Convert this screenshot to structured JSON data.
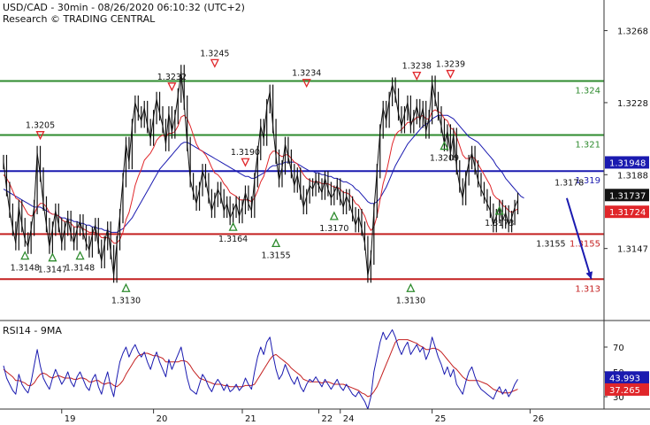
{
  "header": {
    "line1": "USD/CAD - 30min - 08/26/2020 06:10:32 (UTC+2)",
    "line2": "Research © TRADING CENTRAL"
  },
  "rsi_title": "RSI14 - 9MA",
  "chart_data": [
    {
      "type": "line",
      "name": "price",
      "ylim": [
        1.3108,
        1.3285
      ],
      "y_ticks": [
        "1.3268",
        "1.3228",
        "1.3188",
        "1.3147"
      ],
      "y_tick_values": [
        1.3268,
        1.3228,
        1.3188,
        1.3147
      ],
      "x_ticks": [
        "19",
        "20",
        "21",
        "22",
        "24",
        "25",
        "26"
      ],
      "x_tick_index": [
        19,
        49,
        78,
        103,
        110,
        140,
        172
      ],
      "close": [
        1.3195,
        1.318,
        1.3168,
        1.3158,
        1.315,
        1.317,
        1.316,
        1.3152,
        1.3148,
        1.3158,
        1.317,
        1.32,
        1.3188,
        1.3172,
        1.316,
        1.3148,
        1.3158,
        1.3168,
        1.316,
        1.315,
        1.3158,
        1.3164,
        1.3155,
        1.315,
        1.3158,
        1.3162,
        1.3156,
        1.315,
        1.3146,
        1.3155,
        1.316,
        1.3148,
        1.314,
        1.315,
        1.3158,
        1.3145,
        1.3132,
        1.315,
        1.3165,
        1.3185,
        1.3205,
        1.3195,
        1.3215,
        1.3228,
        1.3222,
        1.3218,
        1.3225,
        1.3215,
        1.3208,
        1.322,
        1.323,
        1.3222,
        1.3215,
        1.3205,
        1.3222,
        1.3212,
        1.322,
        1.3232,
        1.3245,
        1.3228,
        1.3205,
        1.3185,
        1.3178,
        1.3172,
        1.318,
        1.319,
        1.3185,
        1.3176,
        1.3168,
        1.3174,
        1.318,
        1.3176,
        1.3168,
        1.3172,
        1.3164,
        1.3168,
        1.3172,
        1.3165,
        1.317,
        1.3178,
        1.3172,
        1.3168,
        1.3185,
        1.32,
        1.3215,
        1.3208,
        1.3226,
        1.3234,
        1.3215,
        1.3198,
        1.3185,
        1.3192,
        1.3205,
        1.3198,
        1.319,
        1.3182,
        1.3188,
        1.3178,
        1.317,
        1.3176,
        1.3182,
        1.318,
        1.3185,
        1.3182,
        1.3178,
        1.3186,
        1.318,
        1.3175,
        1.3178,
        1.3182,
        1.3175,
        1.317,
        1.3176,
        1.3172,
        1.3166,
        1.316,
        1.3165,
        1.3158,
        1.315,
        1.3132,
        1.3142,
        1.3168,
        1.319,
        1.3212,
        1.3225,
        1.3218,
        1.323,
        1.3238,
        1.3232,
        1.3222,
        1.3215,
        1.3222,
        1.3228,
        1.3215,
        1.322,
        1.3226,
        1.3218,
        1.3225,
        1.3212,
        1.322,
        1.3239,
        1.323,
        1.3222,
        1.3215,
        1.3205,
        1.3212,
        1.32,
        1.321,
        1.3192,
        1.3182,
        1.3175,
        1.3186,
        1.3195,
        1.32,
        1.3192,
        1.3185,
        1.318,
        1.3176,
        1.3172,
        1.3168,
        1.316,
        1.3165,
        1.317,
        1.3162,
        1.3167,
        1.316,
        1.3164,
        1.317,
        1.3174
      ],
      "ma_fast": [
        1.3188,
        1.3186,
        1.3183,
        1.3179,
        1.3175,
        1.3174,
        1.3172,
        1.3169,
        1.3166,
        1.3165,
        1.3166,
        1.317,
        1.3172,
        1.3172,
        1.317,
        1.3167,
        1.3166,
        1.3166,
        1.3165,
        1.3163,
        1.3162,
        1.3162,
        1.3161,
        1.3159,
        1.3159,
        1.3159,
        1.3158,
        1.3157,
        1.3156,
        1.3156,
        1.3156,
        1.3155,
        1.3153,
        1.3153,
        1.3153,
        1.3152,
        1.315,
        1.315,
        1.3152,
        1.3156,
        1.3163,
        1.3167,
        1.3174,
        1.3182,
        1.3187,
        1.3191,
        1.3196,
        1.3198,
        1.32,
        1.3203,
        1.3207,
        1.3209,
        1.321,
        1.3209,
        1.3211,
        1.3211,
        1.3212,
        1.3215,
        1.322,
        1.3221,
        1.3219,
        1.3215,
        1.321,
        1.3205,
        1.3202,
        1.3201,
        1.3199,
        1.3196,
        1.3192,
        1.3189,
        1.3188,
        1.3186,
        1.3183,
        1.3181,
        1.3178,
        1.3177,
        1.3176,
        1.3174,
        1.3174,
        1.3174,
        1.3174,
        1.3173,
        1.3175,
        1.3179,
        1.3184,
        1.3187,
        1.3193,
        1.3199,
        1.3201,
        1.3201,
        1.3199,
        1.3198,
        1.3199,
        1.3199,
        1.3197,
        1.3195,
        1.3194,
        1.3191,
        1.3188,
        1.3186,
        1.3185,
        1.3184,
        1.3184,
        1.3184,
        1.3183,
        1.3183,
        1.3183,
        1.3182,
        1.3181,
        1.3181,
        1.318,
        1.3178,
        1.3178,
        1.3177,
        1.3175,
        1.3172,
        1.3171,
        1.3168,
        1.3165,
        1.316,
        1.3157,
        1.3159,
        1.3165,
        1.3174,
        1.3183,
        1.3189,
        1.3197,
        1.3205,
        1.321,
        1.3212,
        1.3213,
        1.3215,
        1.3217,
        1.3217,
        1.3218,
        1.322,
        1.322,
        1.3221,
        1.3219,
        1.3219,
        1.3223,
        1.3224,
        1.3223,
        1.3222,
        1.3219,
        1.3218,
        1.3214,
        1.3213,
        1.3209,
        1.3204,
        1.3199,
        1.3197,
        1.3197,
        1.3198,
        1.3197,
        1.3194,
        1.3191,
        1.3188,
        1.3185,
        1.3182,
        1.3177,
        1.3175,
        1.3174,
        1.3171,
        1.317,
        1.3168,
        1.3167,
        1.3168,
        1.3169
      ],
      "ma_slow": [
        1.318,
        1.3179,
        1.3178,
        1.3177,
        1.3176,
        1.3175,
        1.3174,
        1.3173,
        1.3172,
        1.3171,
        1.317,
        1.317,
        1.317,
        1.3169,
        1.3168,
        1.3167,
        1.3166,
        1.3166,
        1.3165,
        1.3164,
        1.3164,
        1.3163,
        1.3163,
        1.3162,
        1.3162,
        1.3161,
        1.3161,
        1.316,
        1.316,
        1.3159,
        1.3159,
        1.3158,
        1.3158,
        1.3157,
        1.3157,
        1.3156,
        1.3156,
        1.3156,
        1.3157,
        1.3158,
        1.316,
        1.3162,
        1.3164,
        1.3167,
        1.317,
        1.3173,
        1.3176,
        1.3179,
        1.3182,
        1.3185,
        1.3188,
        1.3191,
        1.3193,
        1.3195,
        1.3197,
        1.3199,
        1.3201,
        1.3203,
        1.3205,
        1.3206,
        1.3206,
        1.3205,
        1.3204,
        1.3203,
        1.3202,
        1.3201,
        1.32,
        1.3199,
        1.3198,
        1.3197,
        1.3196,
        1.3195,
        1.3194,
        1.3193,
        1.3192,
        1.3191,
        1.319,
        1.3189,
        1.3188,
        1.3187,
        1.3187,
        1.3186,
        1.3186,
        1.3187,
        1.3188,
        1.3189,
        1.319,
        1.3192,
        1.3193,
        1.3193,
        1.3194,
        1.3194,
        1.3195,
        1.3195,
        1.3195,
        1.3195,
        1.3194,
        1.3193,
        1.3192,
        1.3191,
        1.319,
        1.319,
        1.3189,
        1.3189,
        1.3188,
        1.3188,
        1.3187,
        1.3187,
        1.3186,
        1.3186,
        1.3185,
        1.3184,
        1.3184,
        1.3183,
        1.3182,
        1.318,
        1.3179,
        1.3177,
        1.3175,
        1.3173,
        1.3172,
        1.3172,
        1.3173,
        1.3175,
        1.3178,
        1.3181,
        1.3185,
        1.3189,
        1.3193,
        1.3196,
        1.3199,
        1.3202,
        1.3205,
        1.3207,
        1.3209,
        1.3211,
        1.3213,
        1.3215,
        1.3216,
        1.3217,
        1.3219,
        1.322,
        1.3221,
        1.3221,
        1.3221,
        1.3221,
        1.322,
        1.3219,
        1.3217,
        1.3215,
        1.3213,
        1.3211,
        1.3209,
        1.3208,
        1.3207,
        1.3206,
        1.3204,
        1.3202,
        1.32,
        1.3198,
        1.3196,
        1.3193,
        1.3191,
        1.3189,
        1.3186,
        1.3184,
        1.3182,
        1.318,
        1.3178,
        1.3176,
        1.3175
      ],
      "levels": [
        {
          "label": "1.324",
          "value": 1.324,
          "color": "#2e8b2e"
        },
        {
          "label": "1.321",
          "value": 1.321,
          "color": "#2e8b2e"
        },
        {
          "label": "1.319",
          "value": 1.319,
          "color": "#1a1ab0"
        },
        {
          "label": "1.3155",
          "value": 1.3155,
          "color": "#c42020"
        },
        {
          "label": "1.313",
          "value": 1.313,
          "color": "#c42020"
        }
      ],
      "price_tags": [
        {
          "label": "1.31948",
          "value": 1.31948,
          "color": "#1a1ab0"
        },
        {
          "label": "1.31737",
          "value": 1.31737,
          "color": "#111111"
        },
        {
          "label": "1.31724",
          "value": 1.31724,
          "color": "#e0262a"
        }
      ],
      "markers": [
        {
          "label": "1.3205",
          "index": 12,
          "value": 1.3205,
          "kind": "high"
        },
        {
          "label": "1.3232",
          "index": 55,
          "value": 1.3232,
          "kind": "high"
        },
        {
          "label": "1.3245",
          "index": 69,
          "value": 1.3245,
          "kind": "high"
        },
        {
          "label": "1.3190",
          "index": 79,
          "value": 1.319,
          "kind": "high"
        },
        {
          "label": "1.3234",
          "index": 99,
          "value": 1.3234,
          "kind": "high"
        },
        {
          "label": "1.3238",
          "index": 135,
          "value": 1.3238,
          "kind": "high"
        },
        {
          "label": "1.3239",
          "index": 146,
          "value": 1.3239,
          "kind": "high"
        },
        {
          "label": "1.3148",
          "index": 7,
          "value": 1.3148,
          "kind": "low"
        },
        {
          "label": "1.3147",
          "index": 16,
          "value": 1.3147,
          "kind": "low"
        },
        {
          "label": "1.3148",
          "index": 25,
          "value": 1.3148,
          "kind": "low"
        },
        {
          "label": "1.3130",
          "index": 40,
          "value": 1.313,
          "kind": "low"
        },
        {
          "label": "1.3164",
          "index": 75,
          "value": 1.3164,
          "kind": "low"
        },
        {
          "label": "1.3155",
          "index": 89,
          "value": 1.3155,
          "kind": "low"
        },
        {
          "label": "1.3170",
          "index": 108,
          "value": 1.317,
          "kind": "low"
        },
        {
          "label": "1.3130",
          "index": 133,
          "value": 1.313,
          "kind": "low"
        },
        {
          "label": "1.3209",
          "index": 144,
          "value": 1.3209,
          "kind": "low"
        },
        {
          "label": "1.3173",
          "index": 162,
          "value": 1.3173,
          "kind": "low"
        }
      ],
      "side_labels": [
        {
          "label": "1.3178",
          "index": 180,
          "value": 1.3182
        },
        {
          "label": "1.3155",
          "index": 174,
          "value": 1.3148
        }
      ],
      "projection": {
        "from_index": 184,
        "from_value": 1.3175,
        "to_index": 192,
        "to_value": 1.313,
        "color": "#1a1ab0"
      }
    },
    {
      "type": "line",
      "name": "RSI14 - 9MA",
      "ylim": [
        20,
        90
      ],
      "y_ticks": [
        "70",
        "50",
        "30"
      ],
      "y_tick_values": [
        70,
        50,
        30
      ],
      "rsi": [
        55,
        45,
        40,
        35,
        32,
        48,
        40,
        36,
        33,
        42,
        55,
        68,
        55,
        45,
        40,
        36,
        45,
        52,
        46,
        40,
        44,
        50,
        42,
        38,
        46,
        50,
        44,
        38,
        35,
        44,
        48,
        38,
        32,
        42,
        50,
        38,
        30,
        45,
        58,
        65,
        70,
        62,
        68,
        72,
        66,
        62,
        66,
        58,
        52,
        60,
        66,
        58,
        52,
        46,
        60,
        52,
        58,
        64,
        70,
        58,
        45,
        36,
        34,
        32,
        40,
        48,
        44,
        38,
        34,
        40,
        44,
        40,
        35,
        40,
        34,
        36,
        40,
        35,
        38,
        45,
        40,
        36,
        50,
        62,
        70,
        64,
        74,
        78,
        64,
        52,
        44,
        48,
        56,
        50,
        44,
        40,
        46,
        38,
        34,
        40,
        44,
        42,
        46,
        42,
        38,
        44,
        40,
        36,
        40,
        44,
        38,
        35,
        40,
        36,
        32,
        30,
        34,
        30,
        26,
        20,
        30,
        50,
        62,
        74,
        82,
        76,
        80,
        84,
        78,
        70,
        64,
        70,
        74,
        64,
        68,
        72,
        66,
        70,
        60,
        66,
        78,
        70,
        62,
        56,
        48,
        54,
        46,
        52,
        40,
        36,
        32,
        42,
        50,
        54,
        46,
        40,
        36,
        34,
        32,
        30,
        28,
        34,
        38,
        32,
        36,
        30,
        34,
        40,
        44
      ],
      "ma": [
        52,
        50,
        48,
        46,
        43,
        43,
        42,
        41,
        39,
        39,
        41,
        45,
        48,
        49,
        48,
        46,
        45,
        46,
        47,
        46,
        45,
        45,
        45,
        44,
        44,
        45,
        45,
        44,
        42,
        42,
        43,
        43,
        41,
        40,
        41,
        41,
        39,
        38,
        40,
        43,
        48,
        52,
        56,
        60,
        63,
        64,
        65,
        65,
        64,
        63,
        63,
        62,
        61,
        58,
        58,
        58,
        58,
        58,
        59,
        59,
        58,
        55,
        51,
        48,
        45,
        44,
        43,
        42,
        41,
        40,
        40,
        40,
        39,
        39,
        38,
        38,
        38,
        38,
        38,
        39,
        39,
        39,
        40,
        44,
        48,
        52,
        56,
        60,
        63,
        64,
        62,
        60,
        58,
        56,
        53,
        51,
        49,
        47,
        44,
        43,
        42,
        42,
        42,
        42,
        41,
        42,
        42,
        41,
        40,
        40,
        40,
        40,
        39,
        38,
        37,
        36,
        35,
        33,
        32,
        30,
        31,
        34,
        38,
        44,
        50,
        56,
        62,
        68,
        74,
        76,
        76,
        76,
        76,
        75,
        74,
        73,
        71,
        70,
        68,
        68,
        69,
        69,
        68,
        66,
        63,
        60,
        57,
        54,
        52,
        49,
        46,
        44,
        43,
        43,
        43,
        43,
        42,
        41,
        40,
        38,
        36,
        35,
        34,
        33,
        33,
        33,
        34,
        35,
        36
      ],
      "tags": [
        {
          "label": "43.993",
          "value": 43.993,
          "color": "#1a1ab0"
        },
        {
          "label": "37.265",
          "value": 37.265,
          "color": "#e0262a"
        }
      ]
    }
  ],
  "colors": {
    "price": "#111111",
    "ma_fast": "#e0262a",
    "ma_slow": "#1a1ab0",
    "rsi": "#1a1ab0",
    "rsi_ma": "#c42020",
    "marker_high": "#e0262a",
    "marker_low": "#2e8b2e",
    "frame": "#333333"
  }
}
